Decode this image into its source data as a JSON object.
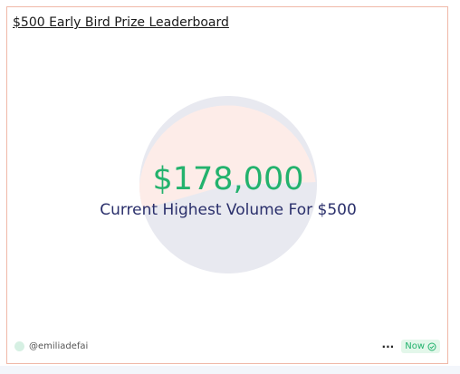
{
  "card": {
    "title": "$500 Early Bird Prize Leaderboard",
    "value": "$178,000",
    "subtitle": "Current Highest Volume For $500"
  },
  "footer": {
    "author": "@emiliadefai",
    "more_label": "···",
    "status": "Now",
    "status_icon": "check-circle-icon"
  },
  "colors": {
    "value": "#23b26d",
    "subtitle": "#2a2f6b",
    "pie_top": "#fdece8",
    "pie_bottom": "#e8e9f0",
    "border": "#f0b8a8"
  }
}
